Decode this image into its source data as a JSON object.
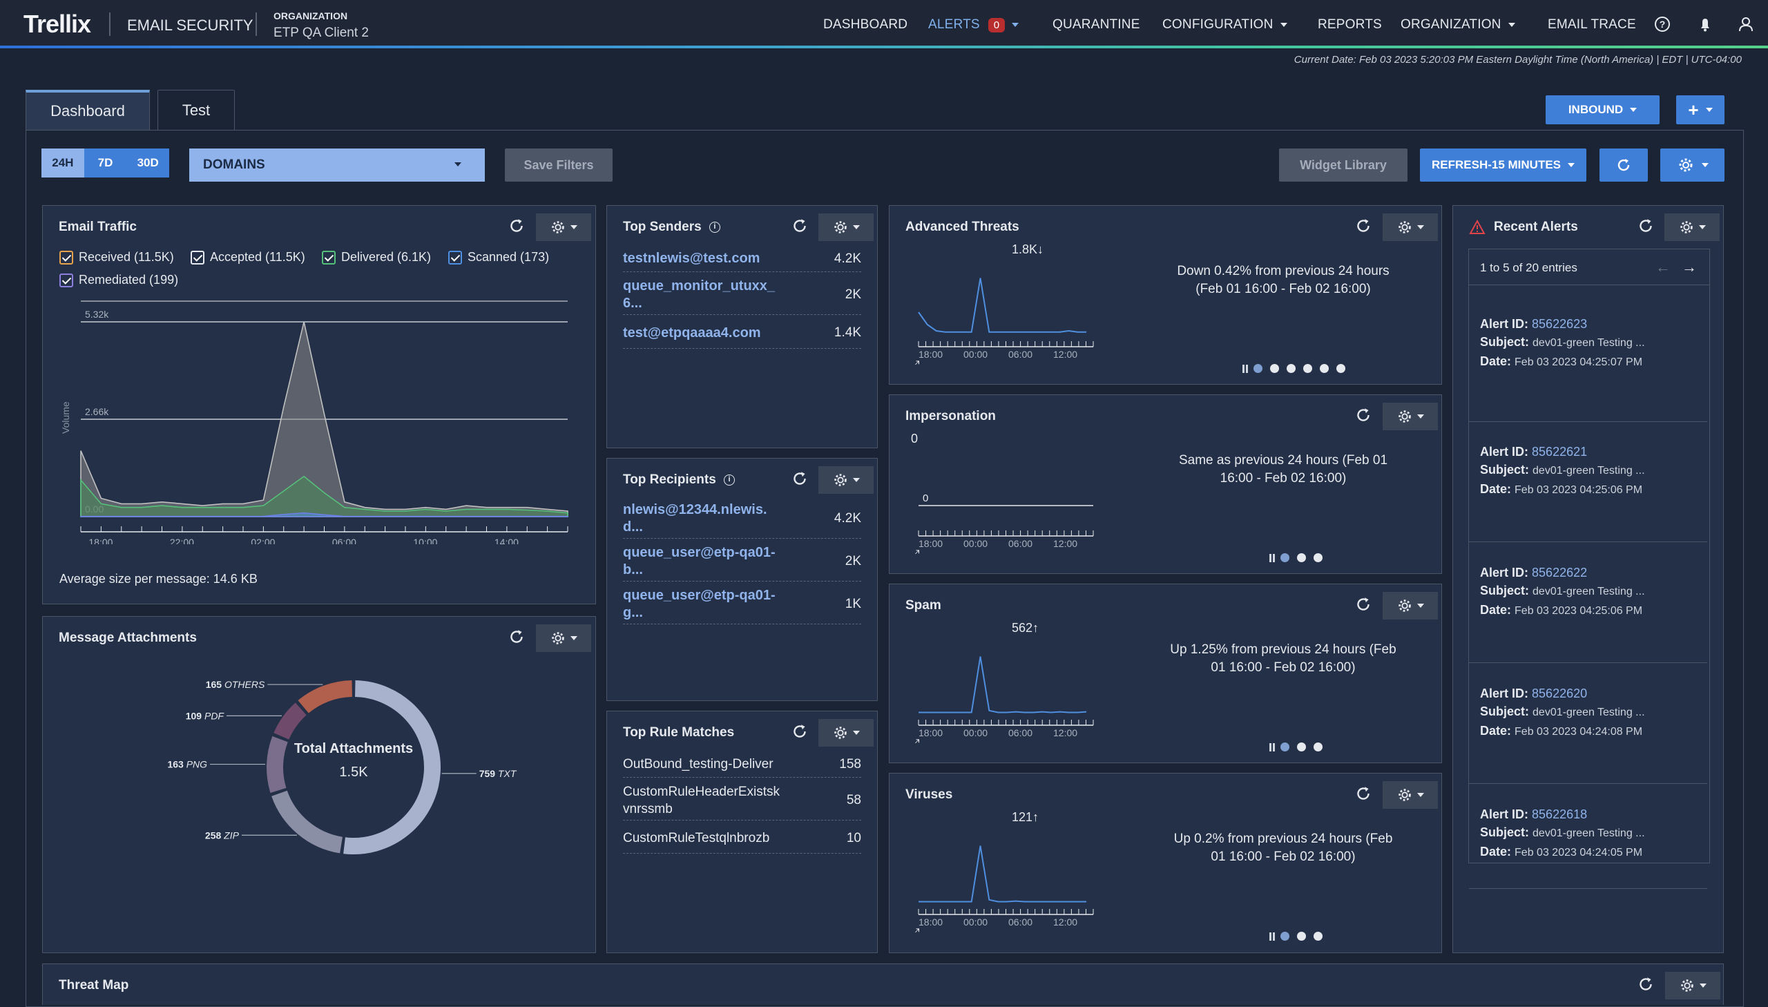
{
  "header": {
    "brand": "Trellix",
    "product": "EMAIL SECURITY",
    "org_label": "ORGANIZATION",
    "org_name": "ETP QA Client 2",
    "nav": {
      "dashboard": "DASHBOARD",
      "alerts": "ALERTS",
      "alerts_count": "0",
      "quarantine": "QUARANTINE",
      "configuration": "CONFIGURATION",
      "reports": "REPORTS",
      "organization": "ORGANIZATION",
      "email_trace": "EMAIL TRACE"
    },
    "icons": [
      "help-icon",
      "bell-icon",
      "user-icon"
    ],
    "current_date": "Current Date: Feb 03 2023 5:20:03 PM Eastern Daylight Time (North America) | EDT | UTC-04:00"
  },
  "tabs": {
    "dashboard": "Dashboard",
    "test": "Test"
  },
  "toolbar": {
    "inbound": "INBOUND",
    "add": "+",
    "time_ranges": [
      "24H",
      "7D",
      "30D"
    ],
    "selected_range": "24H",
    "domains": "DOMAINS",
    "save_filters": "Save Filters",
    "widget_library": "Widget Library",
    "refresh": "REFRESH-15 MINUTES"
  },
  "email_traffic": {
    "title": "Email Traffic",
    "legend": [
      {
        "label": "Received (11.5K)",
        "color": "#e8a24a"
      },
      {
        "label": "Accepted (11.5K)",
        "color": "#e6e9ee"
      },
      {
        "label": "Delivered (6.1K)",
        "color": "#55c07a"
      },
      {
        "label": "Scanned (173)",
        "color": "#4f8fe0"
      },
      {
        "label": "Remediated (199)",
        "color": "#8b7fe0"
      }
    ],
    "ylabel": "Volume",
    "y_ticks": [
      "5.32k",
      "2.66k",
      "0.00"
    ],
    "x_ticks": [
      "18:00",
      "22:00",
      "02:00",
      "06:00",
      "10:00",
      "14:00"
    ],
    "avg_size": "Average size per message: 14.6 KB",
    "chart_data": {
      "type": "area",
      "x": [
        "17:00",
        "18:00",
        "19:00",
        "20:00",
        "21:00",
        "22:00",
        "23:00",
        "00:00",
        "01:00",
        "02:00",
        "03:00",
        "04:00",
        "05:00",
        "06:00",
        "07:00",
        "08:00",
        "09:00",
        "10:00",
        "11:00",
        "12:00",
        "13:00",
        "14:00",
        "15:00",
        "16:00",
        "17:00"
      ],
      "series": [
        {
          "name": "Received",
          "values": [
            1800,
            500,
            350,
            350,
            400,
            350,
            300,
            350,
            350,
            450,
            3000,
            5320,
            2800,
            400,
            250,
            200,
            200,
            250,
            200,
            300,
            250,
            250,
            250,
            200,
            150
          ]
        },
        {
          "name": "Delivered",
          "values": [
            1000,
            350,
            250,
            250,
            300,
            250,
            250,
            250,
            250,
            300,
            700,
            1100,
            650,
            250,
            200,
            150,
            150,
            200,
            150,
            200,
            200,
            200,
            180,
            150,
            100
          ]
        },
        {
          "name": "Scanned",
          "values": [
            5,
            5,
            5,
            5,
            5,
            5,
            5,
            5,
            5,
            10,
            60,
            100,
            50,
            5,
            5,
            5,
            5,
            5,
            5,
            5,
            5,
            5,
            5,
            5,
            5
          ]
        }
      ],
      "ylim": [
        0,
        5320
      ]
    }
  },
  "attachments": {
    "title": "Message Attachments",
    "center_label": "Total Attachments",
    "center_value": "1.5K",
    "chart_data": {
      "type": "pie",
      "slices": [
        {
          "label": "TXT",
          "value": 759,
          "color": "#a9b2cc"
        },
        {
          "label": "ZIP",
          "value": 258,
          "color": "#8a8fa6"
        },
        {
          "label": "PNG",
          "value": 163,
          "color": "#7a6e8c"
        },
        {
          "label": "PDF",
          "value": 109,
          "color": "#6f4a6a"
        },
        {
          "label": "OTHERS",
          "value": 165,
          "color": "#b0604c"
        }
      ]
    }
  },
  "top_senders": {
    "title": "Top Senders",
    "rows": [
      {
        "name": "testnlewis@test.com",
        "count": "4.2K"
      },
      {
        "name": "queue_monitor_utuxx_\n6...",
        "count": "2K"
      },
      {
        "name": "test@etpqaaaa4.com",
        "count": "1.4K"
      }
    ]
  },
  "top_recipients": {
    "title": "Top Recipients",
    "rows": [
      {
        "name": "nlewis@12344.nlewis.\nd...",
        "count": "4.2K"
      },
      {
        "name": "queue_user@etp-qa01-\nb...",
        "count": "2K"
      },
      {
        "name": "queue_user@etp-qa01-\ng...",
        "count": "1K"
      }
    ]
  },
  "top_rules": {
    "title": "Top Rule Matches",
    "rows": [
      {
        "name": "OutBound_testing-Deliver",
        "count": "158"
      },
      {
        "name": "CustomRuleHeaderExistsk\nvnrssmb",
        "count": "58"
      },
      {
        "name": "CustomRuleTestqlnbrozb",
        "count": "10"
      }
    ]
  },
  "threats": [
    {
      "title": "Advanced Threats",
      "value": "1.8K",
      "direction": "down",
      "desc": "Down 0.42% from previous 24 hours (Feb 01 16:00 - Feb 02 16:00)",
      "x_ticks": [
        "18:00",
        "00:00",
        "06:00",
        "12:00"
      ],
      "dots": 6,
      "chart_data": {
        "type": "line",
        "values": [
          40,
          20,
          10,
          8,
          8,
          8,
          8,
          95,
          8,
          8,
          8,
          8,
          8,
          8,
          8,
          8,
          8,
          10,
          8,
          8
        ]
      }
    },
    {
      "title": "Impersonation",
      "value": "0",
      "direction": "",
      "desc": "Same as previous 24 hours (Feb 01 16:00 - Feb 02 16:00)",
      "x_ticks": [
        "18:00",
        "00:00",
        "06:00",
        "12:00"
      ],
      "dots": 3,
      "zero_label": "0",
      "chart_data": {
        "type": "line",
        "values": [
          0,
          0,
          0,
          0,
          0,
          0,
          0,
          0,
          0,
          0,
          0,
          0,
          0,
          0,
          0,
          0,
          0,
          0,
          0,
          0
        ]
      }
    },
    {
      "title": "Spam",
      "value": "562",
      "direction": "up",
      "desc": "Up 1.25% from previous 24 hours (Feb 01 16:00 - Feb 02 16:00)",
      "x_ticks": [
        "18:00",
        "00:00",
        "06:00",
        "12:00"
      ],
      "dots": 3,
      "chart_data": {
        "type": "line",
        "values": [
          5,
          5,
          5,
          5,
          5,
          5,
          5,
          95,
          8,
          5,
          5,
          6,
          5,
          5,
          6,
          5,
          6,
          5,
          5,
          6
        ]
      }
    },
    {
      "title": "Viruses",
      "value": "121",
      "direction": "up",
      "desc": "Up 0.2% from previous 24 hours (Feb 01 16:00 - Feb 02 16:00)",
      "x_ticks": [
        "18:00",
        "00:00",
        "06:00",
        "12:00"
      ],
      "dots": 3,
      "chart_data": {
        "type": "line",
        "values": [
          5,
          5,
          5,
          5,
          5,
          5,
          5,
          95,
          8,
          5,
          5,
          6,
          5,
          5,
          5,
          5,
          5,
          5,
          5,
          5
        ]
      }
    }
  ],
  "recent_alerts": {
    "title": "Recent Alerts",
    "entries": "1 to 5 of 20 entries",
    "labels": {
      "id": "Alert ID:",
      "subject": "Subject:",
      "date": "Date:"
    },
    "items": [
      {
        "id": "85622623",
        "subject": "dev01-green Testing ...",
        "date": "Feb 03 2023 04:25:07 PM"
      },
      {
        "id": "85622621",
        "subject": "dev01-green Testing ...",
        "date": "Feb 03 2023 04:25:06 PM"
      },
      {
        "id": "85622622",
        "subject": "dev01-green Testing ...",
        "date": "Feb 03 2023 04:25:06 PM"
      },
      {
        "id": "85622620",
        "subject": "dev01-green Testing ...",
        "date": "Feb 03 2023 04:24:08 PM"
      },
      {
        "id": "85622618",
        "subject": "dev01-green Testing ...",
        "date": "Feb 03 2023 04:24:05 PM"
      }
    ]
  },
  "threat_map": {
    "title": "Threat Map"
  }
}
